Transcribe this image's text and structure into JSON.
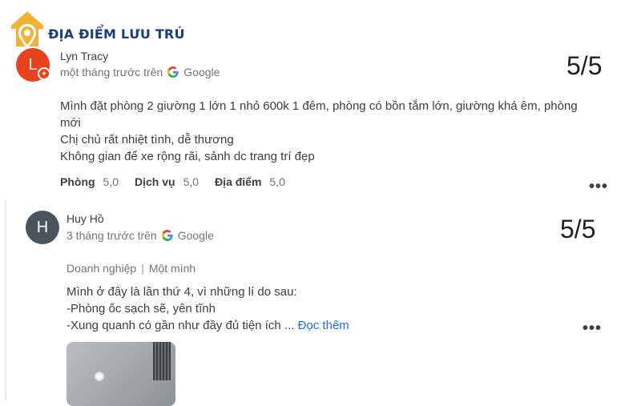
{
  "header": {
    "title": "ĐỊA ĐIỂM LƯU TRÚ"
  },
  "reviews": [
    {
      "avatar_letter": "L",
      "name": "Lyn Tracy",
      "time": "một tháng trước trên",
      "source": "Google",
      "score": "5/5",
      "text_lines": [
        "Mình đặt phòng 2 giường 1 lớn 1 nhỏ 600k 1 đêm, phòng có bồn tắm lớn, giường khá êm, phòng",
        "mới",
        "Chị chủ rất nhiệt tình, dễ thương",
        "Không gian để xe rộng rãi, sảnh dc trang trí đẹp"
      ],
      "ratings": [
        {
          "label": "Phòng",
          "value": "5,0"
        },
        {
          "label": "Dịch vụ",
          "value": "5,0"
        },
        {
          "label": "Địa điểm",
          "value": "5,0"
        }
      ],
      "more": "•••"
    },
    {
      "avatar_letter": "H",
      "name": "Huy Hồ",
      "time": "3 tháng trước trên",
      "source": "Google",
      "score": "5/5",
      "context": {
        "trip_type": "Doanh nghiệp",
        "group": "Một mình"
      },
      "text_lines": [
        "Mình ở đây là lần thứ 4, vì những lí do sau:",
        "-Phòng ốc sạch sẽ, yên tĩnh",
        "-Xung quanh có gần như đầy đủ tiện ích ..."
      ],
      "read_more": "Đọc thêm",
      "more": "•••"
    }
  ],
  "colors": {
    "brand": "#1a3d7c",
    "logo": "#f3b233",
    "link": "#1a73e8",
    "avatar1": "#e8431f",
    "avatar2": "#4a545e"
  }
}
